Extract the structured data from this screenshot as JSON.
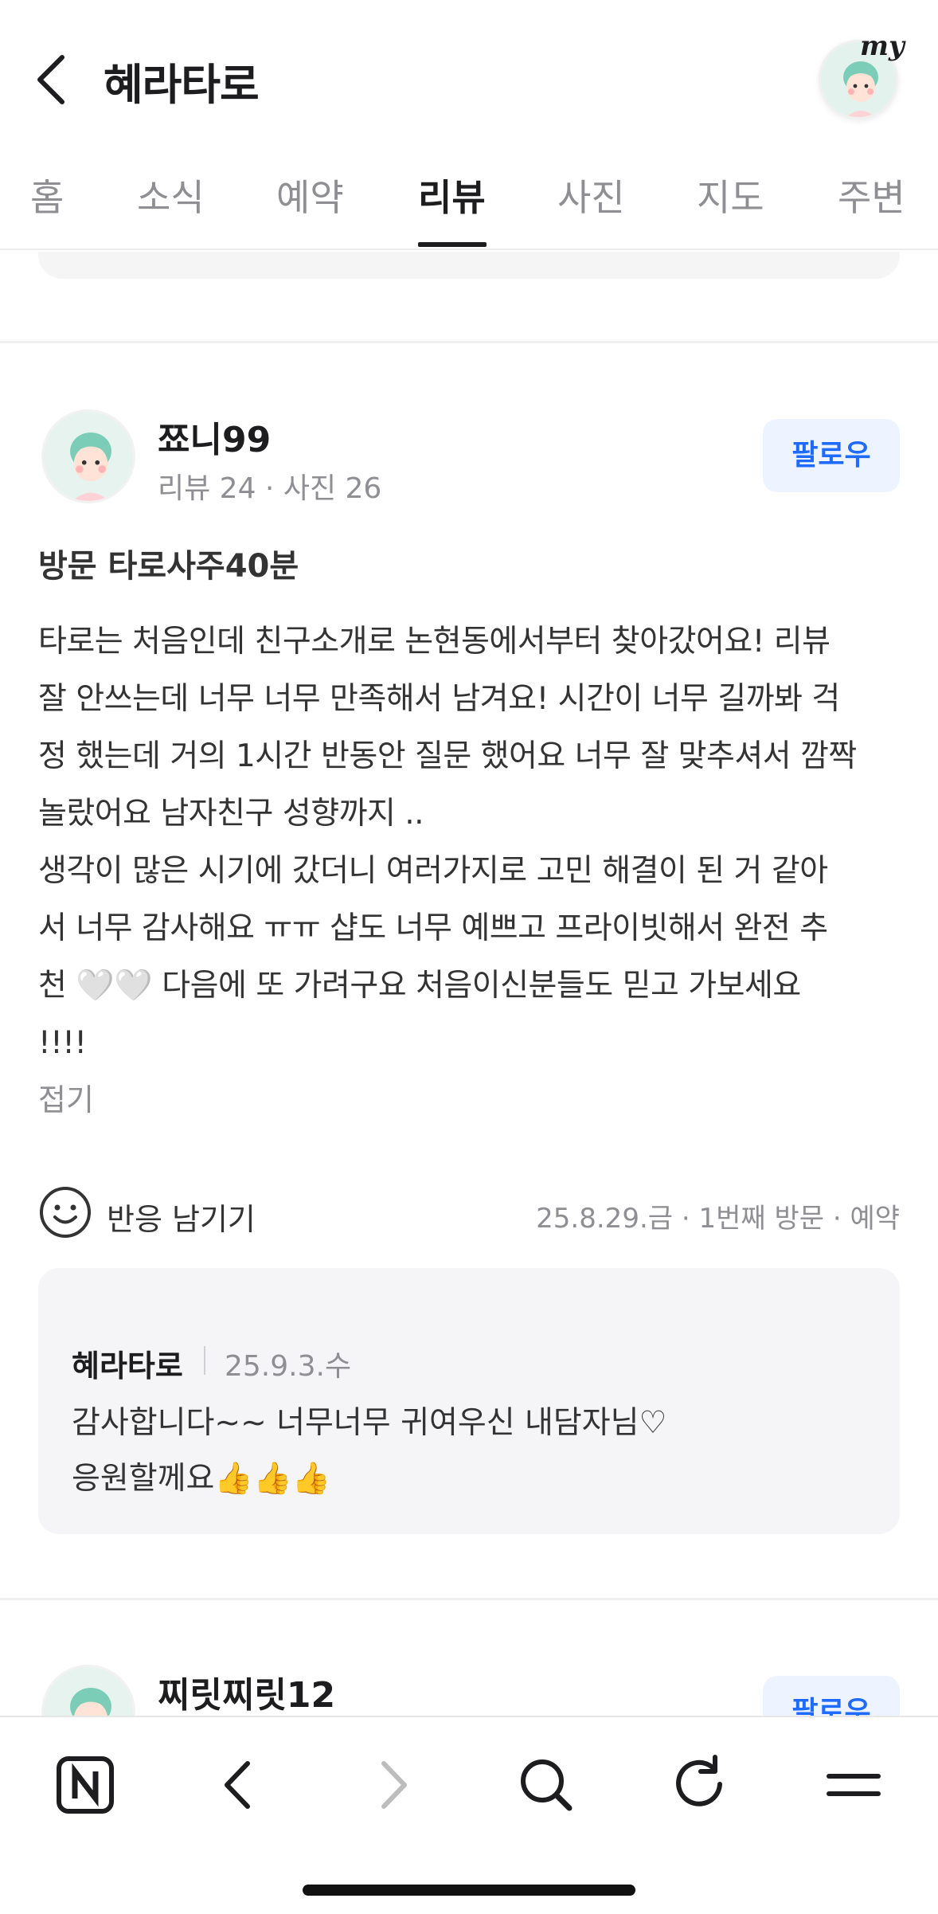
{
  "header": {
    "title": "혜라타로",
    "my_label": "my"
  },
  "tabs": [
    {
      "label": "홈"
    },
    {
      "label": "소식"
    },
    {
      "label": "예약"
    },
    {
      "label": "리뷰",
      "active": true
    },
    {
      "label": "사진"
    },
    {
      "label": "지도"
    },
    {
      "label": "주변"
    }
  ],
  "review": {
    "name": "쬬니99",
    "stats": "리뷰 24 · 사진 26",
    "follow_label": "팔로우",
    "visit_tag": "방문 타로사주40분",
    "body": "타로는 처음인데 친구소개로 논현동에서부터 찾아갔어요! 리뷰\n잘 안쓰는데 너무 너무 만족해서 남겨요! 시간이 너무 길까봐 걱\n정 했는데 거의 1시간 반동안 질문 했어요 너무 잘 맞추셔서 깜짝\n놀랐어요 남자친구 성향까지 ..\n생각이 많은 시기에 갔더니 여러가지로 고민 해결이 된 거 같아\n서 너무 감사해요 ㅠㅠ 샵도 너무 예쁘고 프라이빗해서 완전 추\n천 🤍🤍 다음에 또 가려구요 처음이신분들도 믿고 가보세요\n!!!!",
    "fold_label": "접기",
    "reaction_label": "반응 남기기",
    "meta": "25.8.29.금 · 1번째 방문 · 예약"
  },
  "owner_reply": {
    "name": "혜라타로",
    "date": "25.9.3.수",
    "text": "감사합니다~~ 너무너무 귀여우신 내담자님♡\n응원할께요👍👍👍"
  },
  "next_review": {
    "name": "찌릿찌릿12",
    "follow_label": "팔로우"
  },
  "toolbar": {
    "icons": [
      "naver-n-icon",
      "back-arrow-icon",
      "forward-arrow-icon",
      "search-icon",
      "refresh-icon",
      "menu-icon"
    ]
  },
  "colors": {
    "accent": "#1f6bff",
    "follow_bg": "#eef4ff",
    "muted_text": "#8e8e93",
    "reply_bg": "#f5f5f7"
  }
}
